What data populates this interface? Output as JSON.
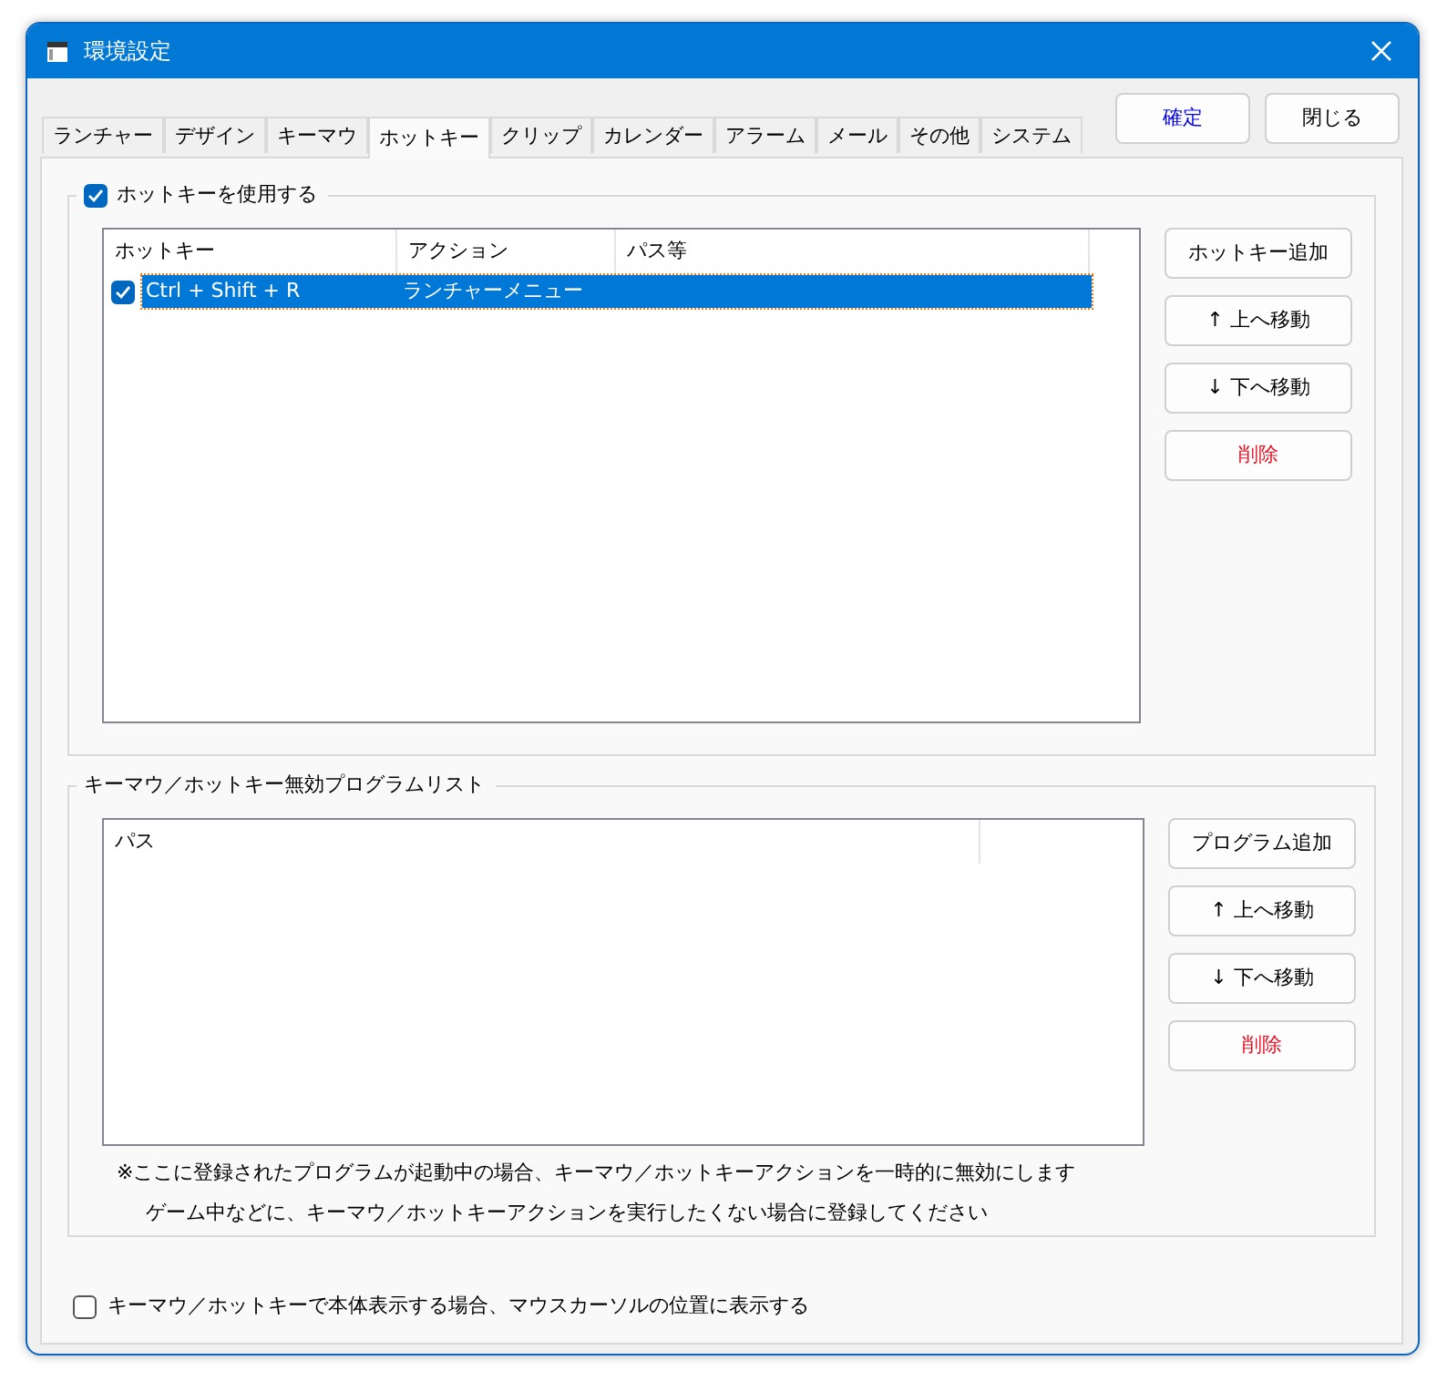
{
  "window": {
    "title": "環境設定"
  },
  "header_buttons": [
    {
      "label": "確定",
      "kind": "primary"
    },
    {
      "label": "閉じる",
      "kind": "normal"
    }
  ],
  "tabs": [
    {
      "label": "ランチャー",
      "selected": false
    },
    {
      "label": "デザイン",
      "selected": false
    },
    {
      "label": "キーマウ",
      "selected": false
    },
    {
      "label": "ホットキー",
      "selected": true
    },
    {
      "label": "クリップ",
      "selected": false
    },
    {
      "label": "カレンダー",
      "selected": false
    },
    {
      "label": "アラーム",
      "selected": false
    },
    {
      "label": "メール",
      "selected": false
    },
    {
      "label": "その他",
      "selected": false
    },
    {
      "label": "システム",
      "selected": false
    }
  ],
  "hotkey_group": {
    "label": "ホットキーを使用する",
    "checked": true,
    "table": {
      "columns": [
        "ホットキー",
        "アクション",
        "パス等"
      ],
      "rows": [
        {
          "checked": true,
          "selected": true,
          "cells": [
            "Ctrl + Shift + R",
            "ランチャーメニュー",
            ""
          ]
        }
      ]
    },
    "buttons": [
      {
        "label": "ホットキー追加",
        "kind": "normal"
      },
      {
        "label": "↑ 上へ移動",
        "kind": "normal"
      },
      {
        "label": "↓ 下へ移動",
        "kind": "normal"
      },
      {
        "label": "削除",
        "kind": "danger"
      }
    ]
  },
  "exclude_group": {
    "label": "キーマウ／ホットキー無効プログラムリスト",
    "table": {
      "columns": [
        "パス"
      ]
    },
    "buttons": [
      {
        "label": "プログラム追加",
        "kind": "normal"
      },
      {
        "label": "↑ 上へ移動",
        "kind": "normal"
      },
      {
        "label": "↓ 下へ移動",
        "kind": "normal"
      },
      {
        "label": "削除",
        "kind": "danger"
      }
    ],
    "notes": [
      "※ここに登録されたプログラムが起動中の場合、キーマウ／ホットキーアクションを一時的に無効にします",
      "ゲーム中などに、キーマウ／ホットキーアクションを実行したくない場合に登録してください"
    ]
  },
  "option": {
    "label": "キーマウ／ホットキーで本体表示する場合、マウスカーソルの位置に表示する",
    "checked": false
  }
}
